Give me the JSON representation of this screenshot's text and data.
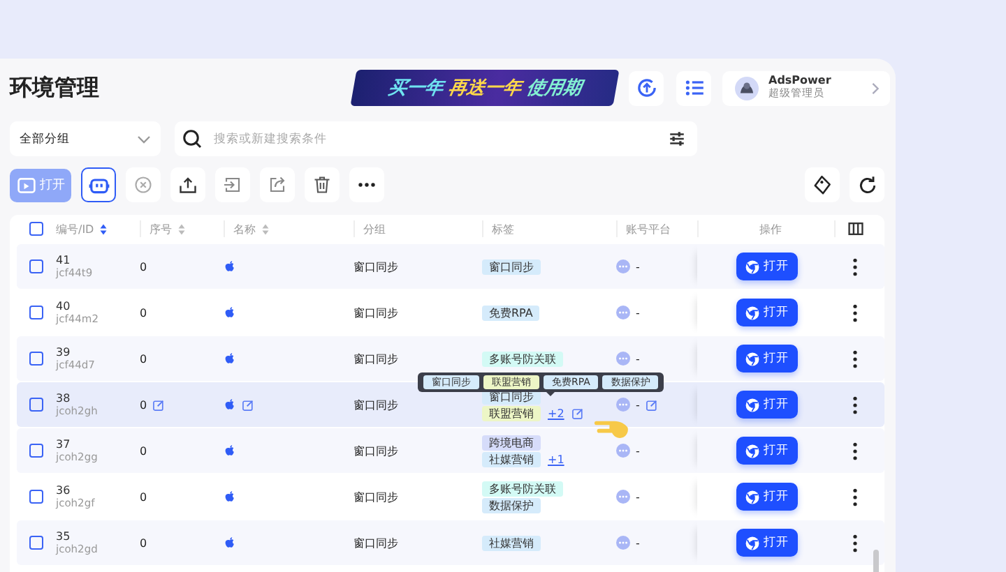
{
  "header": {
    "title": "环境管理",
    "banner": {
      "segments": [
        "买一年",
        "再送一年",
        "使用期"
      ]
    },
    "user": {
      "name": "AdsPower",
      "role": "超级管理员"
    }
  },
  "filters": {
    "group": "全部分组",
    "search": {
      "placeholder": "搜索或新建搜索条件"
    }
  },
  "toolbar": {
    "open_button": {
      "label": "打开",
      "disabled": true
    },
    "tools": [
      {
        "kind": "robot",
        "selected": true
      },
      {
        "kind": "close",
        "selected": false
      },
      {
        "kind": "upload",
        "selected": false
      },
      {
        "kind": "import",
        "selected": false
      },
      {
        "kind": "share",
        "selected": false
      },
      {
        "kind": "delete",
        "selected": false
      },
      {
        "kind": "more",
        "selected": false
      }
    ],
    "right_tools": [
      {
        "kind": "tag"
      },
      {
        "kind": "refresh"
      }
    ]
  },
  "table": {
    "header_checked": false,
    "columns": [
      {
        "label": "编号/ID",
        "sortable": true,
        "sort_active": true
      },
      {
        "label": "序号",
        "sortable": true,
        "sort_active": false
      },
      {
        "label": "名称",
        "sortable": true,
        "sort_active": false
      },
      {
        "label": "分组",
        "sortable": false
      },
      {
        "label": "标签",
        "sortable": false
      },
      {
        "label": "账号平台",
        "sortable": false
      },
      {
        "label": "操作",
        "sortable": false
      }
    ],
    "rows": [
      {
        "number": "41",
        "id": "jcf44t9",
        "order": "0",
        "group": "窗口同步",
        "tags": [
          {
            "label": "窗口同步",
            "color": "#d5ebfb"
          }
        ],
        "platform": "-",
        "action": "打开",
        "checked": false,
        "hovered": false
      },
      {
        "number": "40",
        "id": "jcf44m2",
        "order": "0",
        "group": "窗口同步",
        "tags": [
          {
            "label": "免费RPA",
            "color": "#d5ebfb"
          }
        ],
        "platform": "-",
        "action": "打开",
        "checked": false,
        "hovered": false
      },
      {
        "number": "39",
        "id": "jcf44d7",
        "order": "0",
        "group": "窗口同步",
        "tags": [
          {
            "label": "多账号防关联",
            "color": "#d3faf5"
          }
        ],
        "platform": "-",
        "action": "打开",
        "checked": false,
        "hovered": false
      },
      {
        "number": "38",
        "id": "jcoh2gh",
        "order": "0",
        "group": "窗口同步",
        "tags": [
          {
            "label": "窗口同步",
            "color": "#d5ebfb"
          },
          {
            "label": "联盟营销",
            "color": "#edf6c6"
          }
        ],
        "more": "+2",
        "platform": "-",
        "action": "打开",
        "checked": false,
        "hovered": true,
        "tooltip": [
          {
            "label": "窗口同步",
            "color": "#d5ebfb"
          },
          {
            "label": "联盟营销",
            "color": "#edf6c6"
          },
          {
            "label": "免费RPA",
            "color": "#d5ebfb"
          },
          {
            "label": "数据保护",
            "color": "#d5ebfb"
          }
        ]
      },
      {
        "number": "37",
        "id": "jcoh2gg",
        "order": "0",
        "group": "窗口同步",
        "tags": [
          {
            "label": "跨境电商",
            "color": "#d6dcfa"
          },
          {
            "label": "社媒营销",
            "color": "#d5ebfb"
          }
        ],
        "more": "+1",
        "platform": "-",
        "action": "打开",
        "checked": false,
        "hovered": false
      },
      {
        "number": "36",
        "id": "jcoh2gf",
        "order": "0",
        "group": "窗口同步",
        "tags": [
          {
            "label": "多账号防关联",
            "color": "#d3faf5"
          },
          {
            "label": "数据保护",
            "color": "#d5ebfb"
          }
        ],
        "platform": "-",
        "action": "打开",
        "checked": false,
        "hovered": false
      },
      {
        "number": "35",
        "id": "jcoh2gd",
        "order": "0",
        "group": "窗口同步",
        "tags": [
          {
            "label": "社媒营销",
            "color": "#d5ebfb"
          }
        ],
        "platform": "-",
        "action": "打开",
        "checked": false,
        "hovered": false
      }
    ]
  }
}
